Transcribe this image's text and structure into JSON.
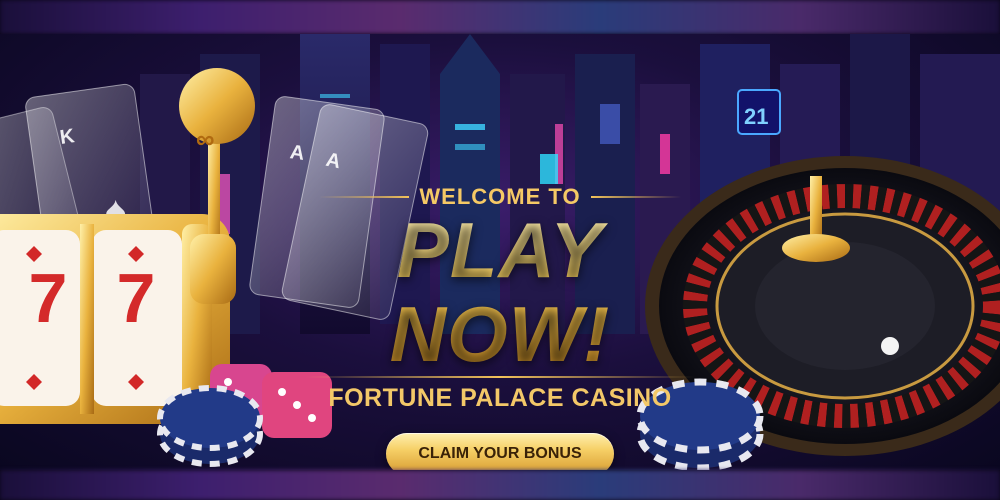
{
  "banner": {
    "welcome_text": "WELCOME TO",
    "headline": "PLAY NOW!",
    "casino_name": "FORTUNE PALACE CASINO",
    "cta_label": "CLAIM YOUR BONUS"
  },
  "decor": {
    "slot_reel_symbols": [
      "7",
      "7"
    ],
    "card_ranks": [
      "K",
      "A",
      "A"
    ],
    "neon_sign_text": "21",
    "slot_lever_icon": "cherries-icon"
  },
  "colors": {
    "gold": "#f5c965",
    "cta_text": "#3a2208",
    "background": "#1b0f3d"
  }
}
